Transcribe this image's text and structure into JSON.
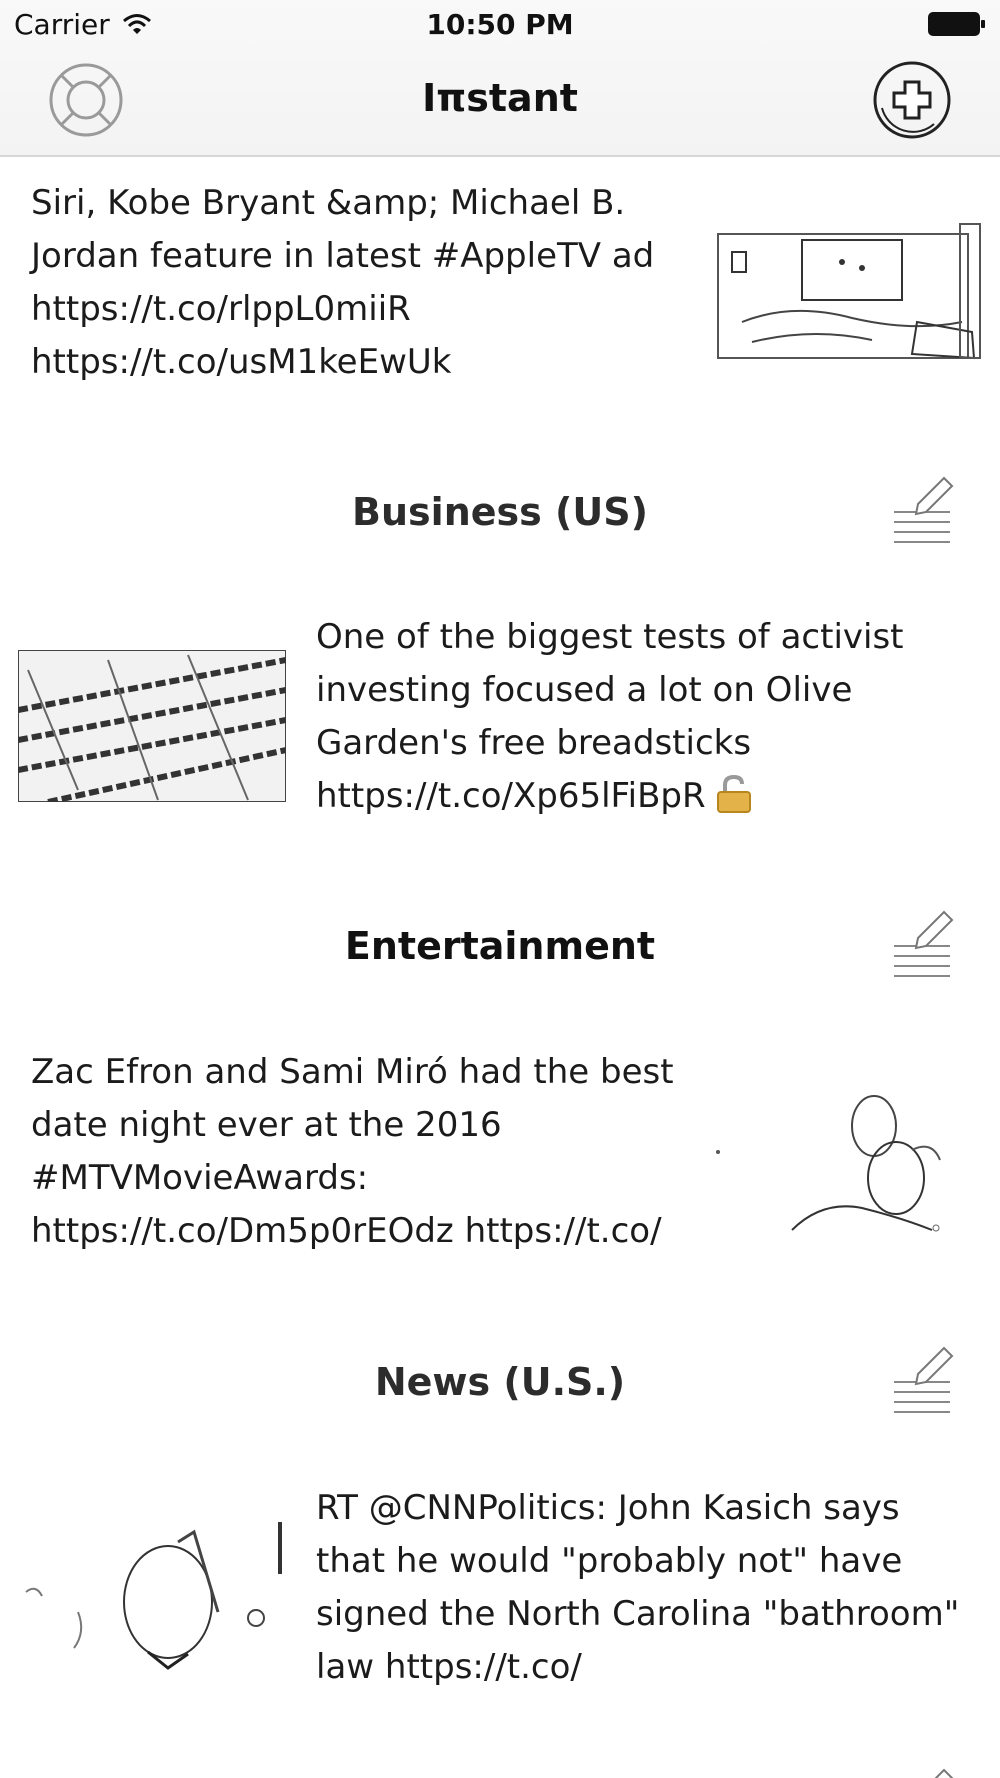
{
  "status_bar": {
    "carrier": "Carrier",
    "time": "10:50 PM"
  },
  "nav": {
    "title": "Iπstant"
  },
  "items": [
    {
      "text": "Siri, Kobe Bryant &amp; Michael B. Jordan feature in latest #AppleTV ad https://t.co/rlppL0miiR https://t.co/usM1keEwUk"
    },
    {
      "text": "One of the biggest tests of activist investing focused a lot on Olive Garden's free breadsticks https://t.co/Xp65lFiBpR"
    },
    {
      "text": "Zac Efron and Sami Miró had the best date night ever at the 2016 #MTVMovieAwards: https://t.co/Dm5p0rEOdz https://t.co/"
    },
    {
      "text": "RT @CNNPolitics: John Kasich says that he would \"probably not\" have signed the North Carolina \"bathroom\" law https://t.co/"
    }
  ],
  "sections": [
    {
      "title": "Business (US)"
    },
    {
      "title": "Entertainment"
    },
    {
      "title": "News (U.S.)"
    }
  ],
  "icons": {
    "help": "lifebuoy-icon",
    "add": "plus-circle-icon",
    "edit": "pencil-lines-icon",
    "lock": "open-lock-icon"
  }
}
